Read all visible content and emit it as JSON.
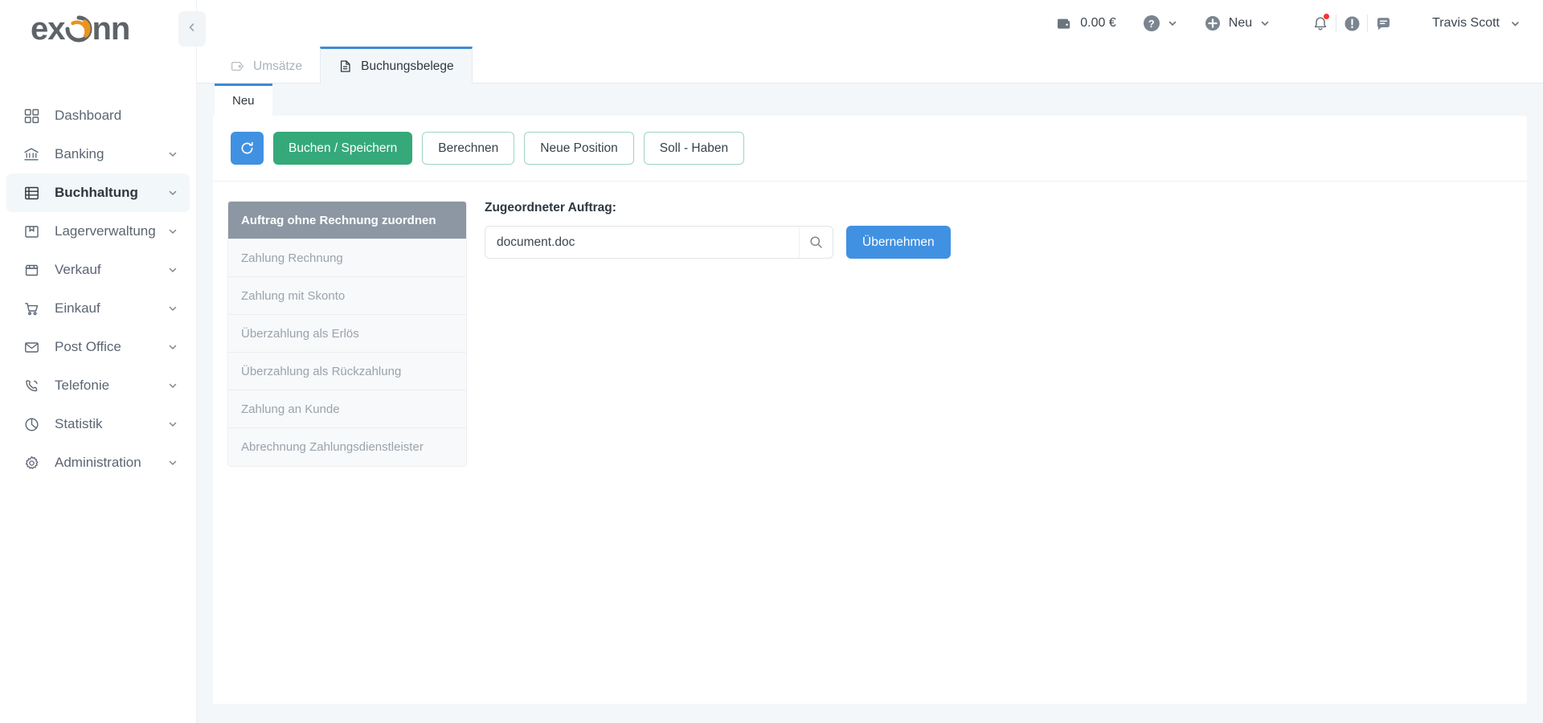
{
  "brand": {
    "logo_text_left": "ex",
    "logo_text_right": "nn",
    "logo_accent_color": "#e8941f",
    "logo_text_color": "#5d6368"
  },
  "sidebar": {
    "collapse_icon": "chevron-left-icon",
    "items": [
      {
        "label": "Dashboard",
        "icon": "grid-icon",
        "expandable": false,
        "active": false
      },
      {
        "label": "Banking",
        "icon": "bank-icon",
        "expandable": true,
        "active": false
      },
      {
        "label": "Buchhaltung",
        "icon": "ledger-icon",
        "expandable": true,
        "active": true
      },
      {
        "label": "Lagerverwaltung",
        "icon": "box-icon",
        "expandable": true,
        "active": false
      },
      {
        "label": "Verkauf",
        "icon": "store-icon",
        "expandable": true,
        "active": false
      },
      {
        "label": "Einkauf",
        "icon": "cart-icon",
        "expandable": true,
        "active": false
      },
      {
        "label": "Post Office",
        "icon": "envelope-icon",
        "expandable": true,
        "active": false
      },
      {
        "label": "Telefonie",
        "icon": "phone-icon",
        "expandable": true,
        "active": false
      },
      {
        "label": "Statistik",
        "icon": "pie-chart-icon",
        "expandable": true,
        "active": false
      },
      {
        "label": "Administration",
        "icon": "gear-icon",
        "expandable": true,
        "active": false
      }
    ]
  },
  "header": {
    "wallet": {
      "icon": "wallet-icon",
      "amount": "0.00 €"
    },
    "help": {
      "icon": "question-circle-icon",
      "chevron": "chevron-down-icon"
    },
    "new": {
      "icon": "plus-circle-icon",
      "label": "Neu",
      "chevron": "chevron-down-icon"
    },
    "notifications": {
      "icon": "bell-icon",
      "has_badge": true,
      "badge_color": "#f5342b"
    },
    "alerts": {
      "icon": "exclamation-circle-icon"
    },
    "notes": {
      "icon": "note-icon"
    },
    "user": {
      "name": "Travis Scott",
      "chevron": "chevron-down-icon"
    }
  },
  "tabs": [
    {
      "label": "Umsätze",
      "icon": "tag-icon",
      "active": false
    },
    {
      "label": "Buchungsbelege",
      "icon": "document-icon",
      "active": true
    }
  ],
  "subtabs": [
    {
      "label": "Neu",
      "active": true
    }
  ],
  "toolbar": {
    "refresh_icon": "refresh-icon",
    "buttons": [
      {
        "label": "Buchen / Speichern",
        "style": "primary-green"
      },
      {
        "label": "Berechnen",
        "style": "outline-green"
      },
      {
        "label": "Neue Position",
        "style": "outline-green"
      },
      {
        "label": "Soll - Haben",
        "style": "outline-green"
      }
    ]
  },
  "booking_types": [
    {
      "label": "Auftrag ohne Rechnung zuordnen",
      "selected": true
    },
    {
      "label": "Zahlung Rechnung",
      "selected": false
    },
    {
      "label": "Zahlung mit Skonto",
      "selected": false
    },
    {
      "label": "Überzahlung als Erlös",
      "selected": false
    },
    {
      "label": "Überzahlung als Rückzahlung",
      "selected": false
    },
    {
      "label": "Zahlung an Kunde",
      "selected": false
    },
    {
      "label": "Abrechnung Zahlungsdienstleister",
      "selected": false
    }
  ],
  "form": {
    "label": "Zugeordneter Auftrag:",
    "input_value": "document.doc",
    "input_placeholder": "",
    "search_icon": "search-icon",
    "apply_label": "Übernehmen"
  },
  "colors": {
    "accent_blue": "#4091e2",
    "accent_green": "#35a979",
    "tab_active_border": "#3d8bd4",
    "selected_row": "#8c97a3",
    "page_bg": "#f4f7f9"
  }
}
